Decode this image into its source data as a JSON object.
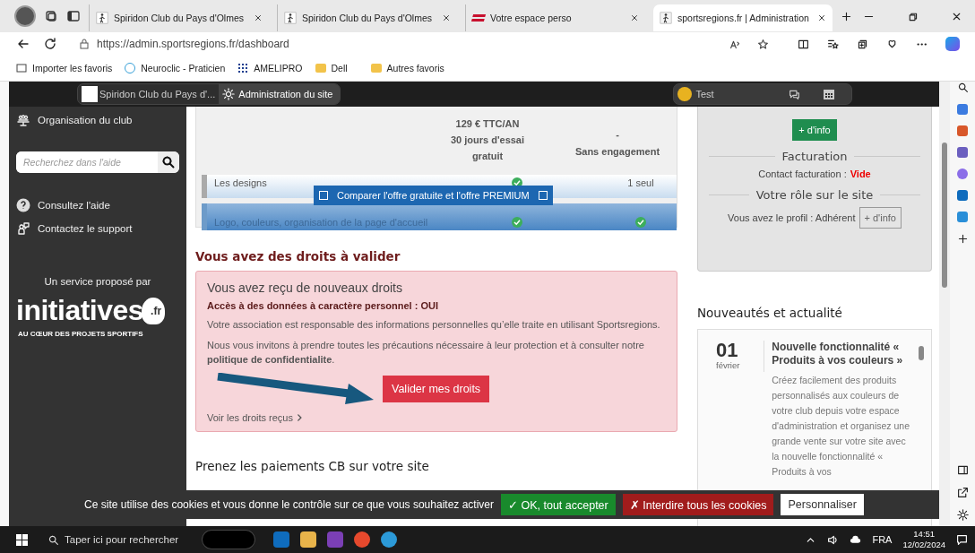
{
  "browser": {
    "tabs": [
      {
        "label": "Spiridon Club du Pays d'Olmes",
        "kind": "club",
        "selected": false
      },
      {
        "label": "Spiridon Club du Pays d'Olmes",
        "kind": "club",
        "selected": false
      },
      {
        "label": "Votre espace perso",
        "kind": "sr",
        "selected": false
      },
      {
        "label": "sportsregions.fr | Administration",
        "kind": "site",
        "selected": true
      }
    ],
    "address": "https://admin.sportsregions.fr/dashboard",
    "favorites": [
      "Importer les favoris",
      "Neuroclic - Praticien",
      "AMELIPRO",
      "Dell"
    ],
    "other_favorites": "Autres favoris"
  },
  "site_header": {
    "club": "Spiridon Club du Pays d'...",
    "admin": "Administration du site",
    "user": "Test"
  },
  "sidebar": {
    "organisation": "Organisation du club",
    "search_placeholder": "Recherchez dans l'aide",
    "links": [
      "Consultez l'aide",
      "Contactez le support"
    ],
    "service": "Un service proposé par",
    "logo": "initiatives",
    "logo_suffix": ".fr",
    "logo_tagline": "AU CŒUR DES PROJETS SPORTIFS"
  },
  "offer": {
    "price": "129 € TTC/AN",
    "trial": "30 jours d'essai gratuit",
    "dash": "-",
    "engagement": "Sans engagement",
    "rows": [
      {
        "label": "Les designs",
        "free": "1 seul"
      },
      {
        "label": "Logo, couleurs, organisation de la page d'accueil"
      }
    ],
    "compare": "Comparer l'offre gratuite et l'offre PREMIUM"
  },
  "rights": {
    "heading": "Vous avez des droits à valider",
    "title": "Vous avez reçu de nouveaux droits",
    "access": "Accès à des données à caractère personnel : OUI",
    "p1": "Votre association est responsable des informations personnelles qu’elle traite en utilisant Sportsregions.",
    "p2": "Nous vous invitons à prendre toutes les précautions nécessaire à leur protection et à consulter notre **politique de confidentialite**.",
    "button": "Valider mes droits",
    "link": "Voir les droits reçus"
  },
  "payments_heading": "Prenez les paiements CB sur votre site",
  "account": {
    "info_button": "+ d'info",
    "billing_title": "Facturation",
    "billing_label": "Contact facturation :",
    "billing_value": "Vide",
    "role_title": "Votre rôle sur le site",
    "profile": "Vous avez le profil : Adhérent",
    "profile_button": "+ d'info"
  },
  "news": {
    "title": "Nouveautés et actualité",
    "items": [
      {
        "day": "01",
        "month": "février",
        "title": "Nouvelle fonctionnalité « Produits à vos couleurs »",
        "body": "Créez facilement des produits personnalisés aux couleurs de votre club depuis votre espace d'administration et organisez une grande vente sur votre site avec la nouvelle fonctionnalité « Produits à vos"
      }
    ]
  },
  "cookie_bar": {
    "text": "Ce site utilise des cookies et vous donne le contrôle sur ce que vous souhaitez activer",
    "accept": "✓ OK, tout accepter",
    "refuse": "✗ Interdire tous les cookies",
    "customize": "Personnaliser"
  },
  "taskbar": {
    "search": "Taper ici pour rechercher",
    "language": "FRA",
    "time": "14:51",
    "date": "12/02/2024"
  }
}
